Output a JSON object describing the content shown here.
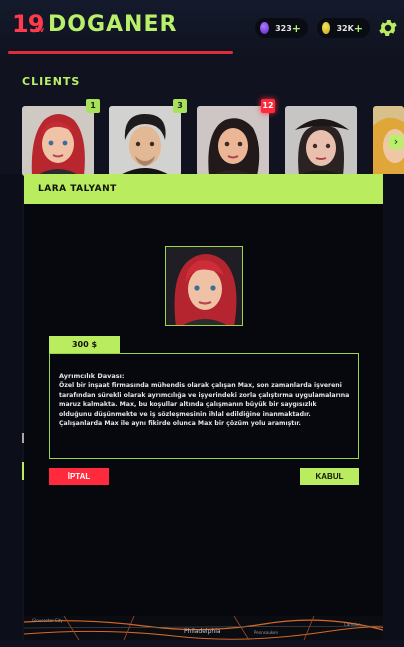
{
  "player": {
    "level": "19",
    "level_suffix": "Lv",
    "name": "DOGANER"
  },
  "currencies": {
    "gems": "323",
    "coins": "32K",
    "add_symbol": "+",
    "gem_icon": "purple-gem-icon",
    "coin_icon": "gold-coin-icon"
  },
  "settings_icon": "gear-icon",
  "clients": {
    "title": "CLIENTS",
    "badges": [
      "1",
      "3",
      "12"
    ],
    "next_icon": "chevron-right-icon"
  },
  "modal": {
    "title": "LARA TALYANT",
    "price": "300 $",
    "case_title": "Ayrımcılık Davası:",
    "case_text": "Özel bir inşaat firmasında mühendis olarak çalışan Max, son zamanlarda işvereni tarafından sürekli olarak ayrımcılığa ve işyerindeki zorla çalıştırma uygulamalarına maruz kalmakta. Max, bu koşullar altında çalışmanın büyük bir saygısızlık olduğunu düşünmekte ve iş sözleşmesinin ihlal edildiğine inanmaktadır. Çalışanlarda Max ile aynı fikirde olunca Max bir çözüm yolu aramıştır.",
    "cancel_label": "İPTAL",
    "accept_label": "KABUL"
  },
  "map": {
    "city_label": "Philadelphia",
    "small_labels": [
      "Gloucester City",
      "Pennsauken",
      "Camden"
    ]
  },
  "colors": {
    "accent_green": "#b9ec5e",
    "accent_red": "#ff2b3c",
    "background": "#10131f",
    "modal_bg": "#07080e"
  }
}
